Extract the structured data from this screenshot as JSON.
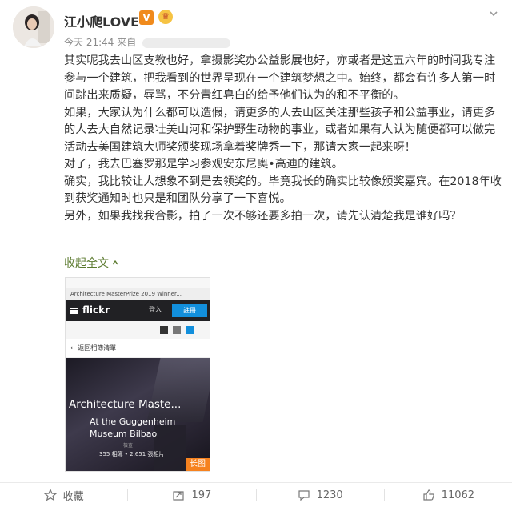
{
  "post": {
    "username": "江小爬LOVE",
    "verified_badge": "V",
    "time": "今天 21:44",
    "source_prefix": "来自",
    "paragraphs": [
      "其实呢我去山区支教也好，拿摄影奖办公益影展也好，亦或者是这五六年的时间我专注参与一个建筑，把我看到的世界呈现在一个建筑梦想之中。始终，都会有许多人第一时间跳出来质疑，辱骂，不分青红皂白的给予他们认为的和不平衡的。",
      "如果，大家认为什么都可以造假，请更多的人去山区关注那些孩子和公益事业，请更多的人去大自然记录壮美山河和保护野生动物的事业，或者如果有人认为随便都可以做完活动去美国建筑大师奖颁奖现场拿着奖牌秀一下，那请大家一起来呀！",
      "对了，我去巴塞罗那是学习参观安东尼奥•高迪的建筑。",
      "确实，我比较让人想象不到是去领奖的。毕竟我长的确实比较像颁奖嘉宾。在2018年收到获奖通知时也只是和团队分享了一下喜悦。",
      "另外，如果我找我合影，拍了一次不够还要多拍一次，请先认清楚我是谁好吗？"
    ],
    "collapse_label": "收起全文"
  },
  "thumbnail": {
    "browser_tab": "Architecture MasterPrize 2019 Winner...",
    "site_logo": "flickr",
    "login_label": "登入",
    "signup_label": "註冊",
    "back_label": "返回相簿清單",
    "title": "Architecture Maste...",
    "subtitle_line1": "At the Guggenheim",
    "subtitle_line2": "Museum Bilbao",
    "faint_label": "檢查",
    "views": "355 相簿 • 2,651 張相片",
    "long_image_label": "长图"
  },
  "actions": {
    "favorite_label": "收藏",
    "repost_count": "197",
    "comment_count": "1230",
    "like_count": "11062"
  },
  "colors": {
    "link_green": "#5b7a2e",
    "vip_orange": "#f08a1c",
    "flickr_blue": "#128fdc",
    "long_image_orange": "#f6821f"
  },
  "icons": [
    "chevron-down-icon",
    "crown-icon",
    "star-icon",
    "repost-icon",
    "comment-icon",
    "like-icon",
    "collapse-arrow-icon"
  ]
}
